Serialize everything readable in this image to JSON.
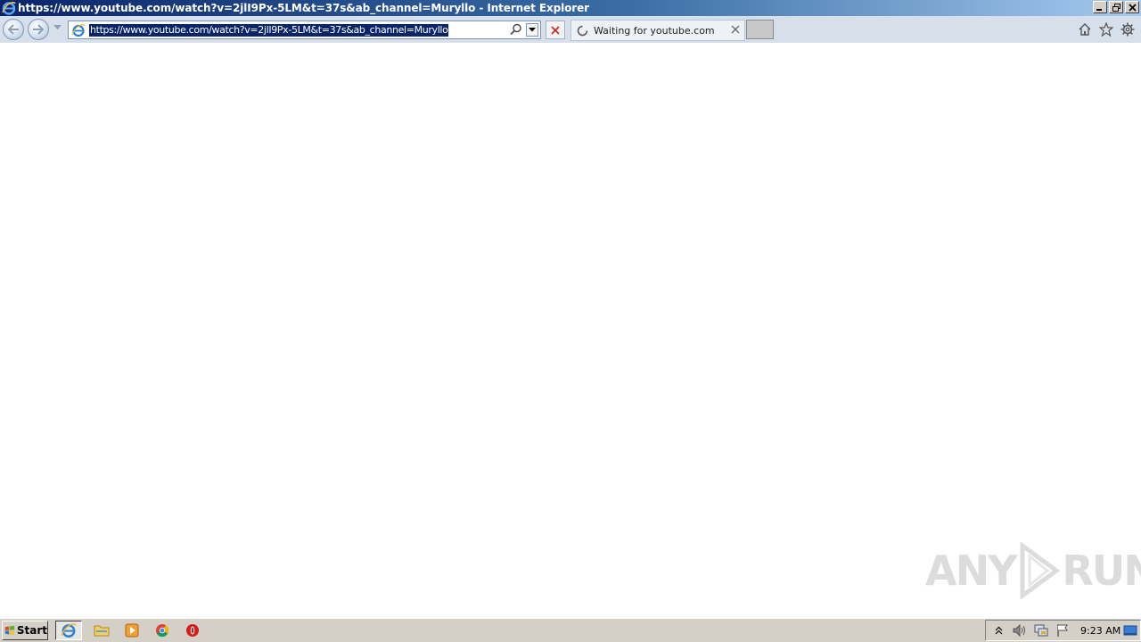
{
  "window": {
    "title": "https://www.youtube.com/watch?v=2jlI9Px-5LM&t=37s&ab_channel=Muryllo - Internet Explorer"
  },
  "address_bar": {
    "url": "https://www.youtube.com/watch?v=2jlI9Px-5LM&t=37s&ab_channel=Muryllo"
  },
  "tab": {
    "label": "Waiting for youtube.com"
  },
  "watermark": {
    "left": "ANY",
    "right": "RUN"
  },
  "taskbar": {
    "start_label": "Start",
    "clock": "9:23 AM"
  },
  "colors": {
    "titlebar_start": "#0a246a",
    "titlebar_end": "#a6caf0",
    "selection": "#0a246a",
    "taskbar": "#d4d0c8"
  }
}
